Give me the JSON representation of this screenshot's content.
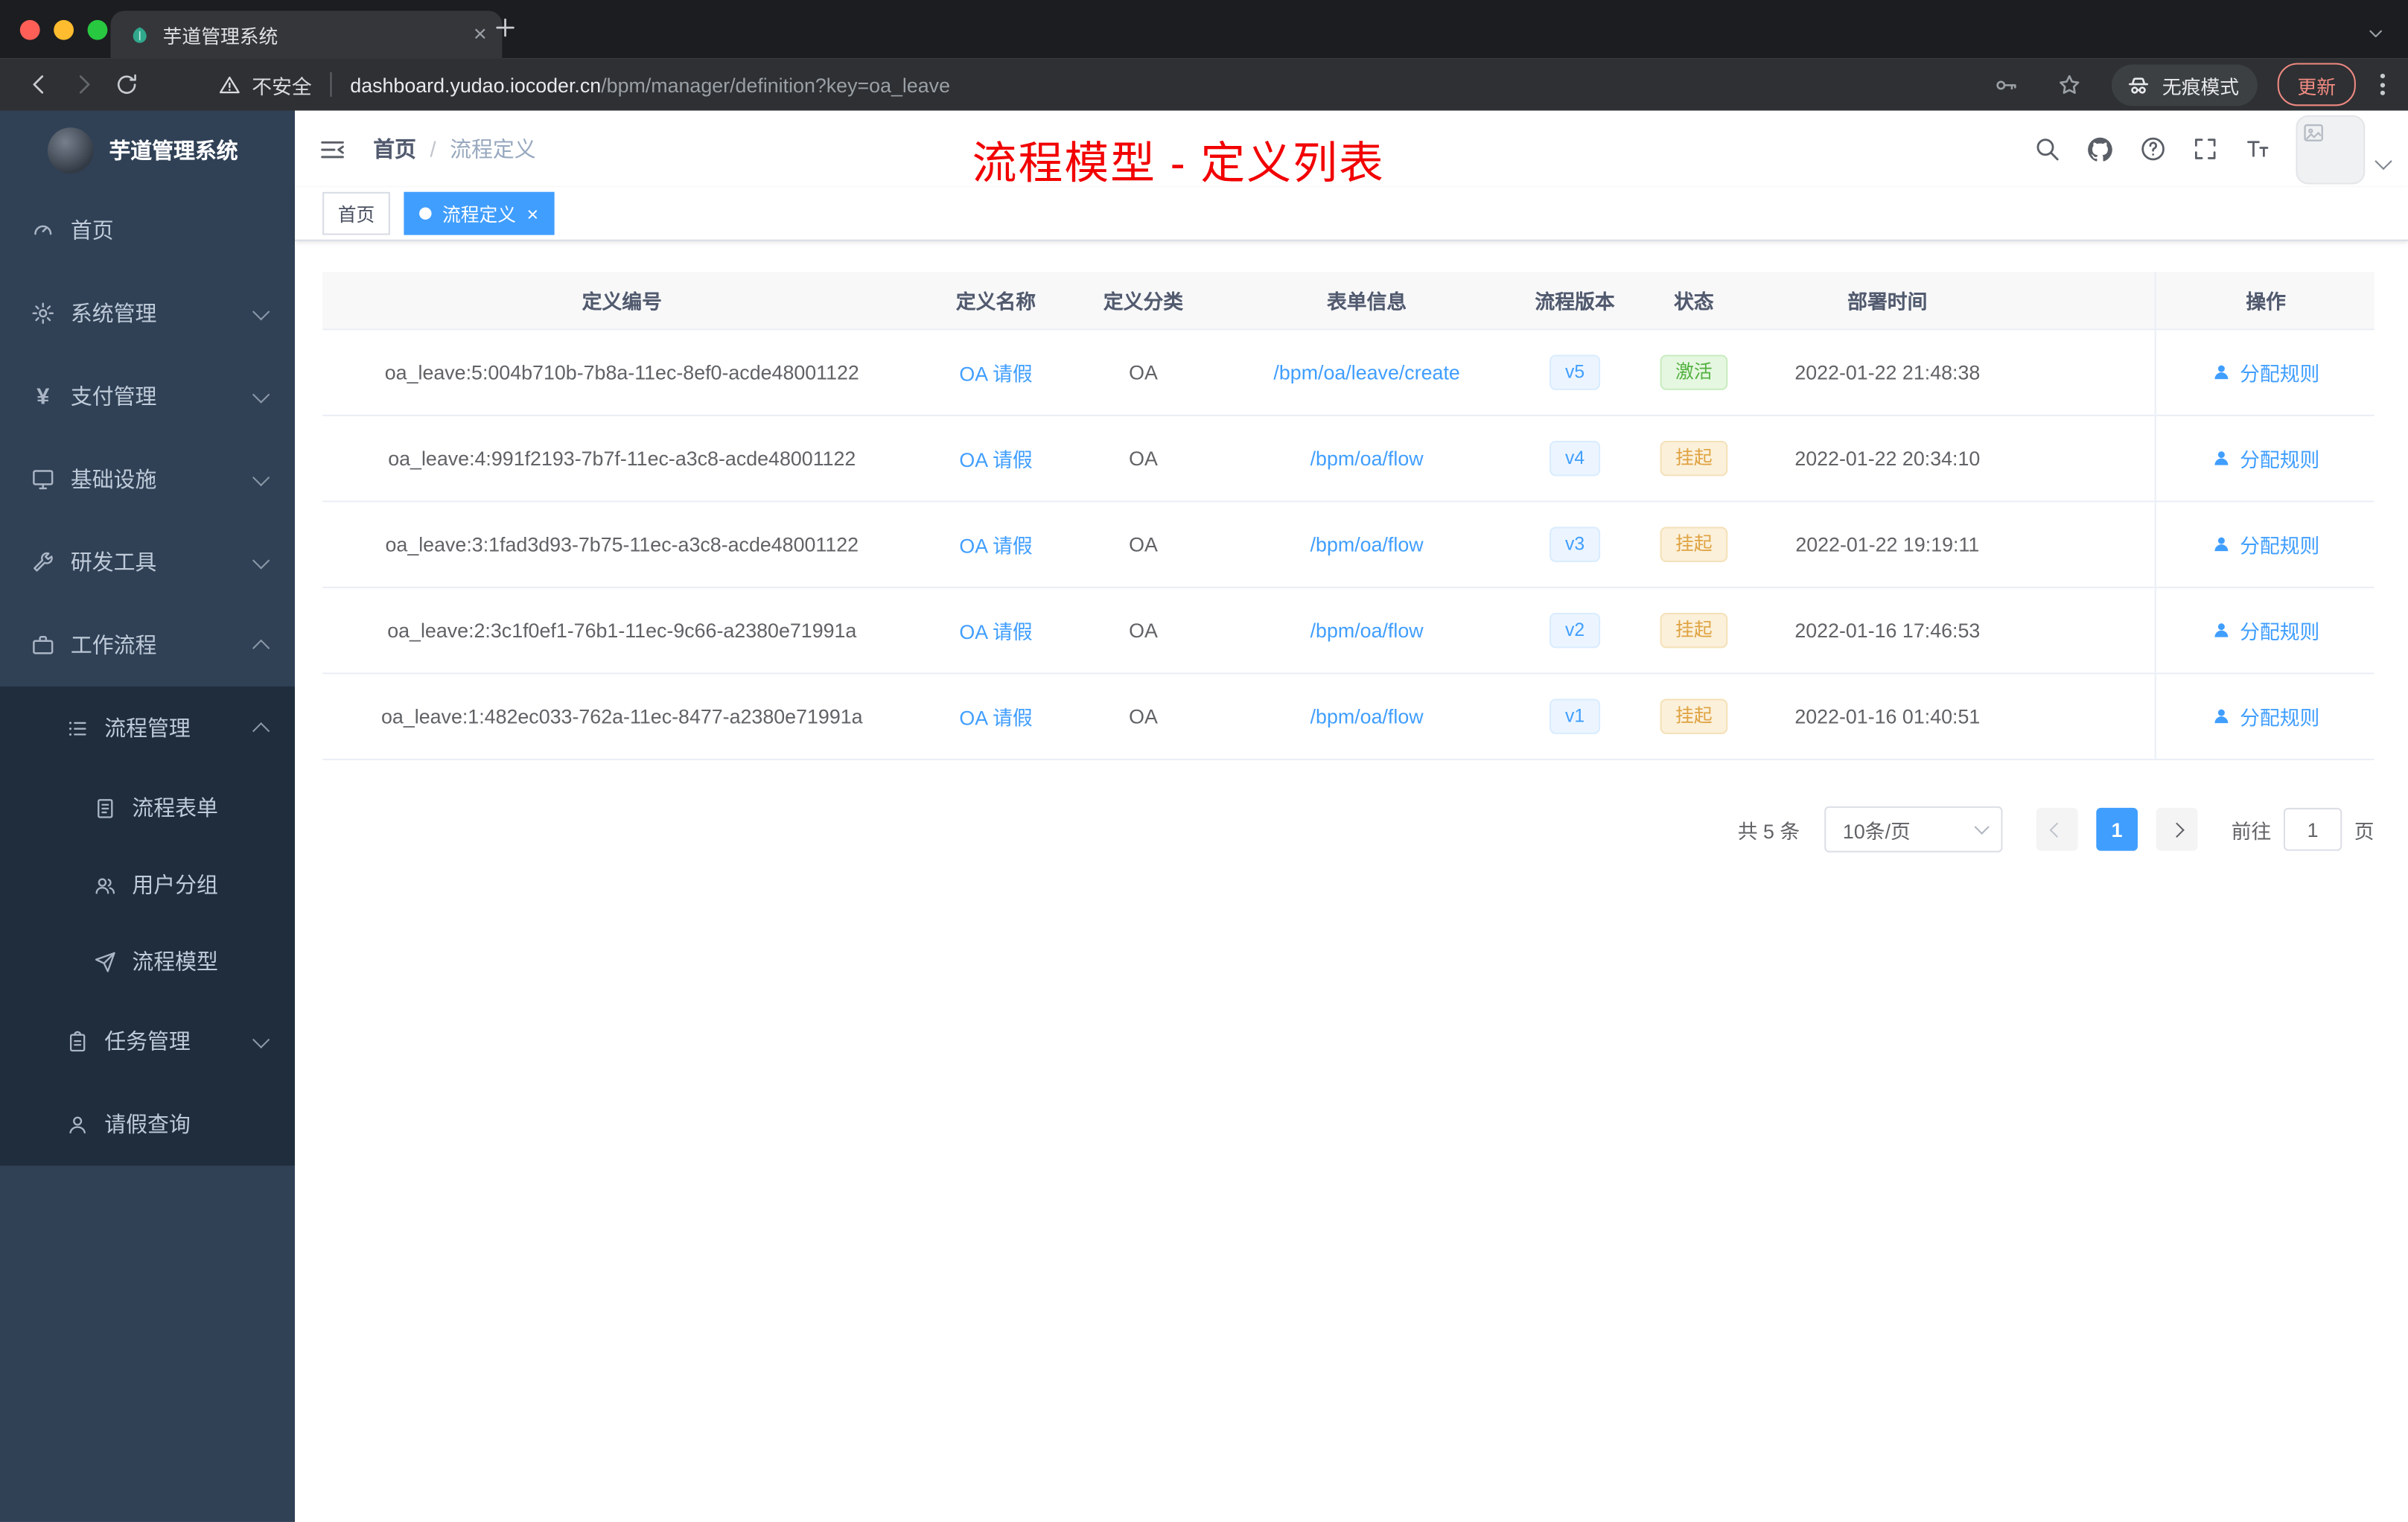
{
  "browser": {
    "tab_title": "芋道管理系统",
    "security_label": "不安全",
    "url_host": "dashboard.yudao.iocoder.cn",
    "url_path": "/bpm/manager/definition?key=oa_leave",
    "incognito_label": "无痕模式",
    "update_label": "更新"
  },
  "sidebar": {
    "brand": "芋道管理系统",
    "menu": [
      {
        "label": "首页",
        "icon": "dashboard-icon"
      },
      {
        "label": "系统管理",
        "icon": "gear-icon"
      },
      {
        "label": "支付管理",
        "icon": "yen-icon"
      },
      {
        "label": "基础设施",
        "icon": "monitor-icon"
      },
      {
        "label": "研发工具",
        "icon": "tool-icon"
      },
      {
        "label": "工作流程",
        "icon": "briefcase-icon"
      }
    ],
    "submenu": {
      "process_label": "流程管理",
      "children": [
        "流程表单",
        "用户分组",
        "流程模型"
      ],
      "task_label": "任务管理",
      "leave_label": "请假查询"
    }
  },
  "header": {
    "breadcrumb_home": "首页",
    "breadcrumb_sep": "/",
    "breadcrumb_current": "流程定义",
    "annotation": "流程模型 - 定义列表"
  },
  "tags": [
    {
      "label": "首页",
      "active": false
    },
    {
      "label": "流程定义",
      "active": true
    }
  ],
  "table": {
    "columns": [
      "定义编号",
      "定义名称",
      "定义分类",
      "表单信息",
      "流程版本",
      "状态",
      "部署时间",
      "操作"
    ],
    "rows": [
      {
        "id": "oa_leave:5:004b710b-7b8a-11ec-8ef0-acde48001122",
        "name": "OA 请假",
        "category": "OA",
        "form": "/bpm/oa/leave/create",
        "version": "v5",
        "status": "激活",
        "status_type": "success",
        "deploy_time": "2022-01-22 21:48:38",
        "action": "分配规则"
      },
      {
        "id": "oa_leave:4:991f2193-7b7f-11ec-a3c8-acde48001122",
        "name": "OA 请假",
        "category": "OA",
        "form": "/bpm/oa/flow",
        "version": "v4",
        "status": "挂起",
        "status_type": "warning",
        "deploy_time": "2022-01-22 20:34:10",
        "action": "分配规则"
      },
      {
        "id": "oa_leave:3:1fad3d93-7b75-11ec-a3c8-acde48001122",
        "name": "OA 请假",
        "category": "OA",
        "form": "/bpm/oa/flow",
        "version": "v3",
        "status": "挂起",
        "status_type": "warning",
        "deploy_time": "2022-01-22 19:19:11",
        "action": "分配规则"
      },
      {
        "id": "oa_leave:2:3c1f0ef1-76b1-11ec-9c66-a2380e71991a",
        "name": "OA 请假",
        "category": "OA",
        "form": "/bpm/oa/flow",
        "version": "v2",
        "status": "挂起",
        "status_type": "warning",
        "deploy_time": "2022-01-16 17:46:53",
        "action": "分配规则"
      },
      {
        "id": "oa_leave:1:482ec033-762a-11ec-8477-a2380e71991a",
        "name": "OA 请假",
        "category": "OA",
        "form": "/bpm/oa/flow",
        "version": "v1",
        "status": "挂起",
        "status_type": "warning",
        "deploy_time": "2022-01-16 01:40:51",
        "action": "分配规则"
      }
    ]
  },
  "pagination": {
    "total": "共 5 条",
    "page_size": "10条/页",
    "current_page": "1",
    "goto_label": "前往",
    "goto_value": "1",
    "page_unit": "页"
  }
}
